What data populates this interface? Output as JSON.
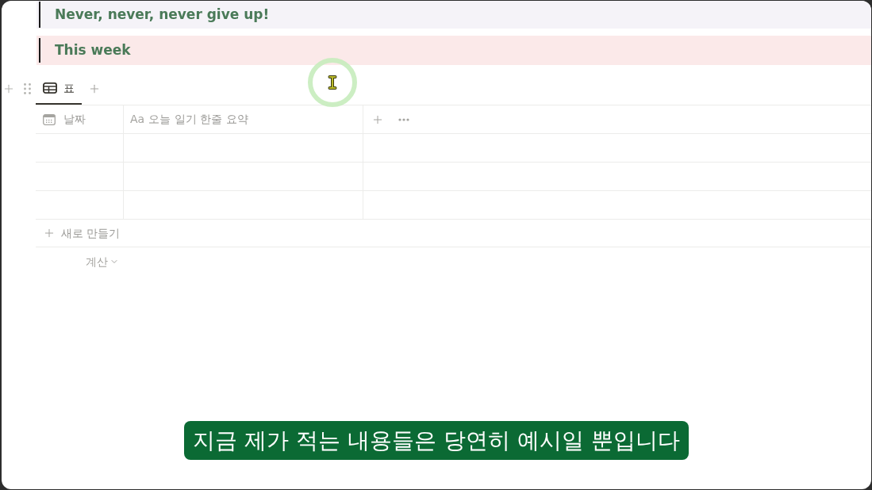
{
  "callouts": [
    {
      "text": "Never, never, never give up!",
      "color": "#f5f3f8"
    },
    {
      "text": "This week",
      "color": "#fbe9e9"
    }
  ],
  "view_tabs": [
    {
      "label": "표",
      "selected": true
    }
  ],
  "table": {
    "columns": [
      {
        "kind": "date",
        "label": "날짜"
      },
      {
        "kind": "title",
        "type_label": "Aa",
        "label": "오늘 일기 한줄 요약"
      }
    ],
    "rows": [
      {
        "kind": "empty"
      },
      {
        "kind": "empty"
      },
      {
        "kind": "empty"
      }
    ],
    "new_row_label": "새로 만들기",
    "calculate_label": "계산"
  },
  "caption": "지금 제가 적는 내용들은 당연히 예시일 뿐입니다"
}
